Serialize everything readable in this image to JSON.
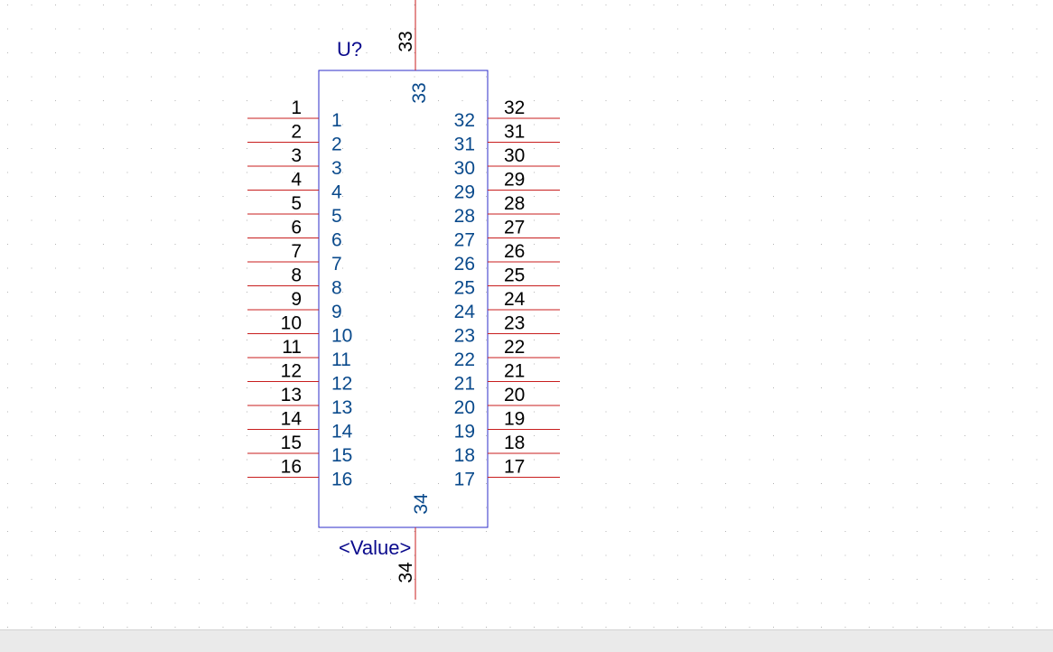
{
  "component": {
    "reference": "U?",
    "value": "<Value>",
    "left_pins": [
      {
        "number": "1",
        "name": "1"
      },
      {
        "number": "2",
        "name": "2"
      },
      {
        "number": "3",
        "name": "3"
      },
      {
        "number": "4",
        "name": "4"
      },
      {
        "number": "5",
        "name": "5"
      },
      {
        "number": "6",
        "name": "6"
      },
      {
        "number": "7",
        "name": "7"
      },
      {
        "number": "8",
        "name": "8"
      },
      {
        "number": "9",
        "name": "9"
      },
      {
        "number": "10",
        "name": "10"
      },
      {
        "number": "11",
        "name": "11"
      },
      {
        "number": "12",
        "name": "12"
      },
      {
        "number": "13",
        "name": "13"
      },
      {
        "number": "14",
        "name": "14"
      },
      {
        "number": "15",
        "name": "15"
      },
      {
        "number": "16",
        "name": "16"
      }
    ],
    "right_pins": [
      {
        "number": "32",
        "name": "32"
      },
      {
        "number": "31",
        "name": "31"
      },
      {
        "number": "30",
        "name": "30"
      },
      {
        "number": "29",
        "name": "29"
      },
      {
        "number": "28",
        "name": "28"
      },
      {
        "number": "27",
        "name": "27"
      },
      {
        "number": "26",
        "name": "26"
      },
      {
        "number": "25",
        "name": "25"
      },
      {
        "number": "24",
        "name": "24"
      },
      {
        "number": "23",
        "name": "23"
      },
      {
        "number": "22",
        "name": "22"
      },
      {
        "number": "21",
        "name": "21"
      },
      {
        "number": "20",
        "name": "20"
      },
      {
        "number": "19",
        "name": "19"
      },
      {
        "number": "18",
        "name": "18"
      },
      {
        "number": "17",
        "name": "17"
      }
    ],
    "top_pin": {
      "number": "33",
      "name": "33"
    },
    "bottom_pin": {
      "number": "34",
      "name": "34"
    }
  },
  "colors": {
    "background": "#ffffff",
    "grid": "#b4b4b4",
    "body_outline": "#2d2dc8",
    "pin_line": "#c81e1e",
    "pin_number": "#000000",
    "pin_name": "#0a4a8c",
    "field_text": "#0a0a8c"
  }
}
